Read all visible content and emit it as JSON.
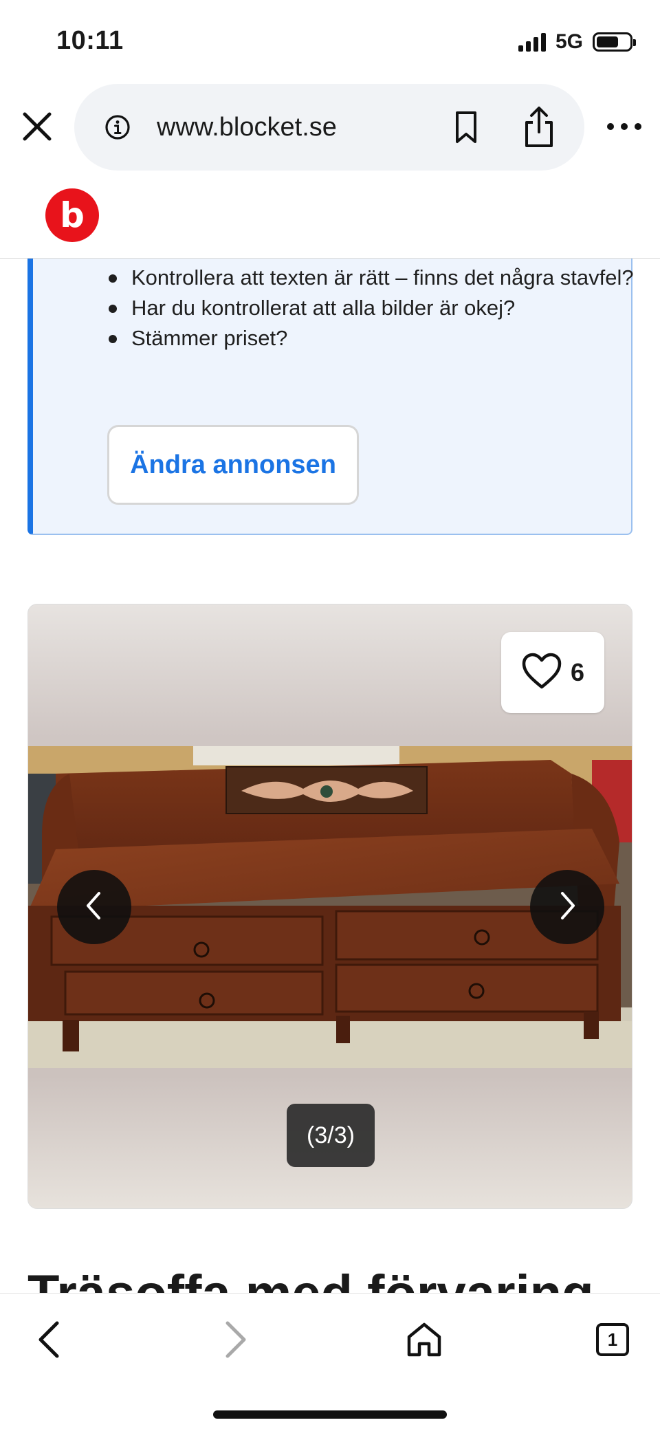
{
  "status_bar": {
    "time": "10:11",
    "network": "5G",
    "icons": [
      "signal-icon",
      "battery-icon"
    ]
  },
  "browser": {
    "url": "www.blocket.se",
    "icons": [
      "close-icon",
      "info-icon",
      "bookmark-icon",
      "share-icon",
      "more-icon"
    ]
  },
  "site": {
    "logo_letter": "b",
    "brand_color": "#e8131b"
  },
  "checklist": {
    "items": [
      "Kontrollera att texten är rätt – finns det några stavfel?",
      "Har du kontrollerat att alla bilder är okej?",
      "Stämmer priset?"
    ],
    "edit_button": "Ändra annonsen",
    "accent_color": "#1b74e4"
  },
  "gallery": {
    "likes": "6",
    "counter": "(3/3)",
    "icons": [
      "heart-icon",
      "chevron-left-icon",
      "chevron-right-icon"
    ]
  },
  "listing": {
    "title": "Träsoffa med förvaring"
  },
  "toolbar": {
    "tab_count": "1",
    "icons": [
      "back-icon",
      "forward-icon",
      "home-icon",
      "tabs-icon"
    ]
  }
}
